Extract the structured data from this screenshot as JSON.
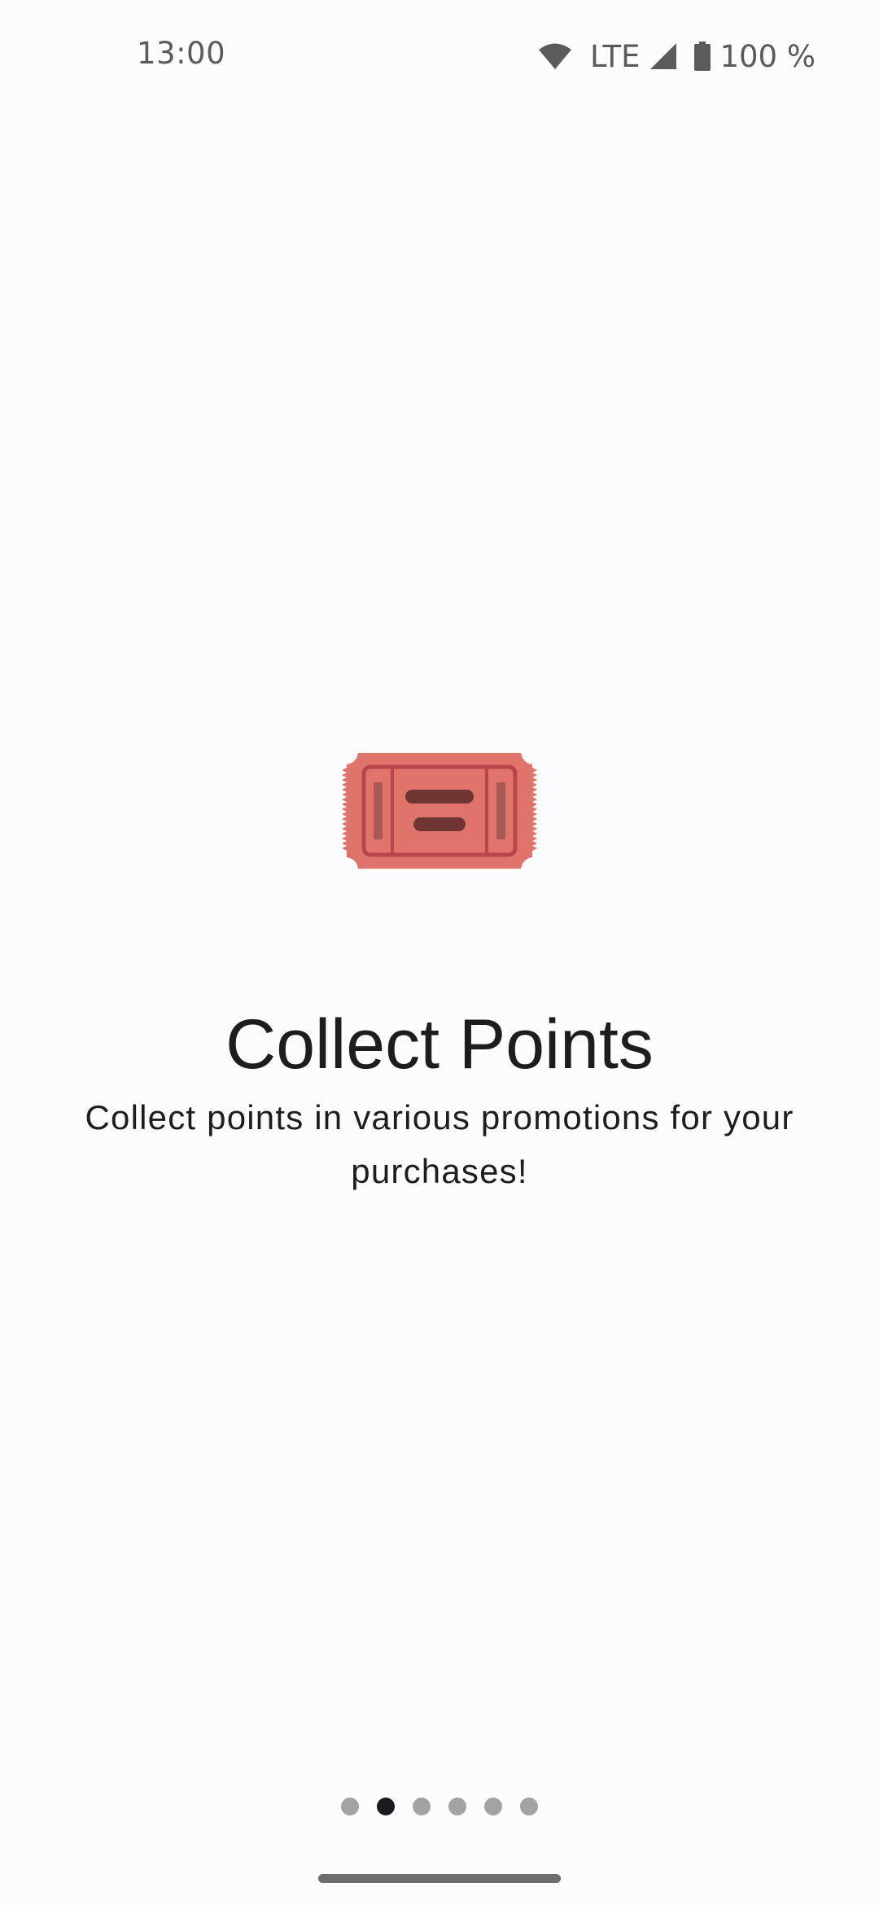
{
  "status_bar": {
    "time": "13:00",
    "network": "LTE",
    "battery": "100 %",
    "icons": [
      "wifi-icon",
      "signal-icon",
      "battery-icon"
    ]
  },
  "onboarding": {
    "illustration": "ticket-icon",
    "title": "Collect Points",
    "subtitle": "Collect points in various promotions for your purchases!"
  },
  "pager": {
    "count": 6,
    "active_index": 1
  },
  "colors": {
    "background": "#fcfcfe",
    "ticket_fill": "#e0736a",
    "ticket_stroke": "#b8454a",
    "ticket_dark": "#6e3533",
    "dot_active": "#1a1b1e",
    "dot_inactive": "#a3a3a6"
  }
}
